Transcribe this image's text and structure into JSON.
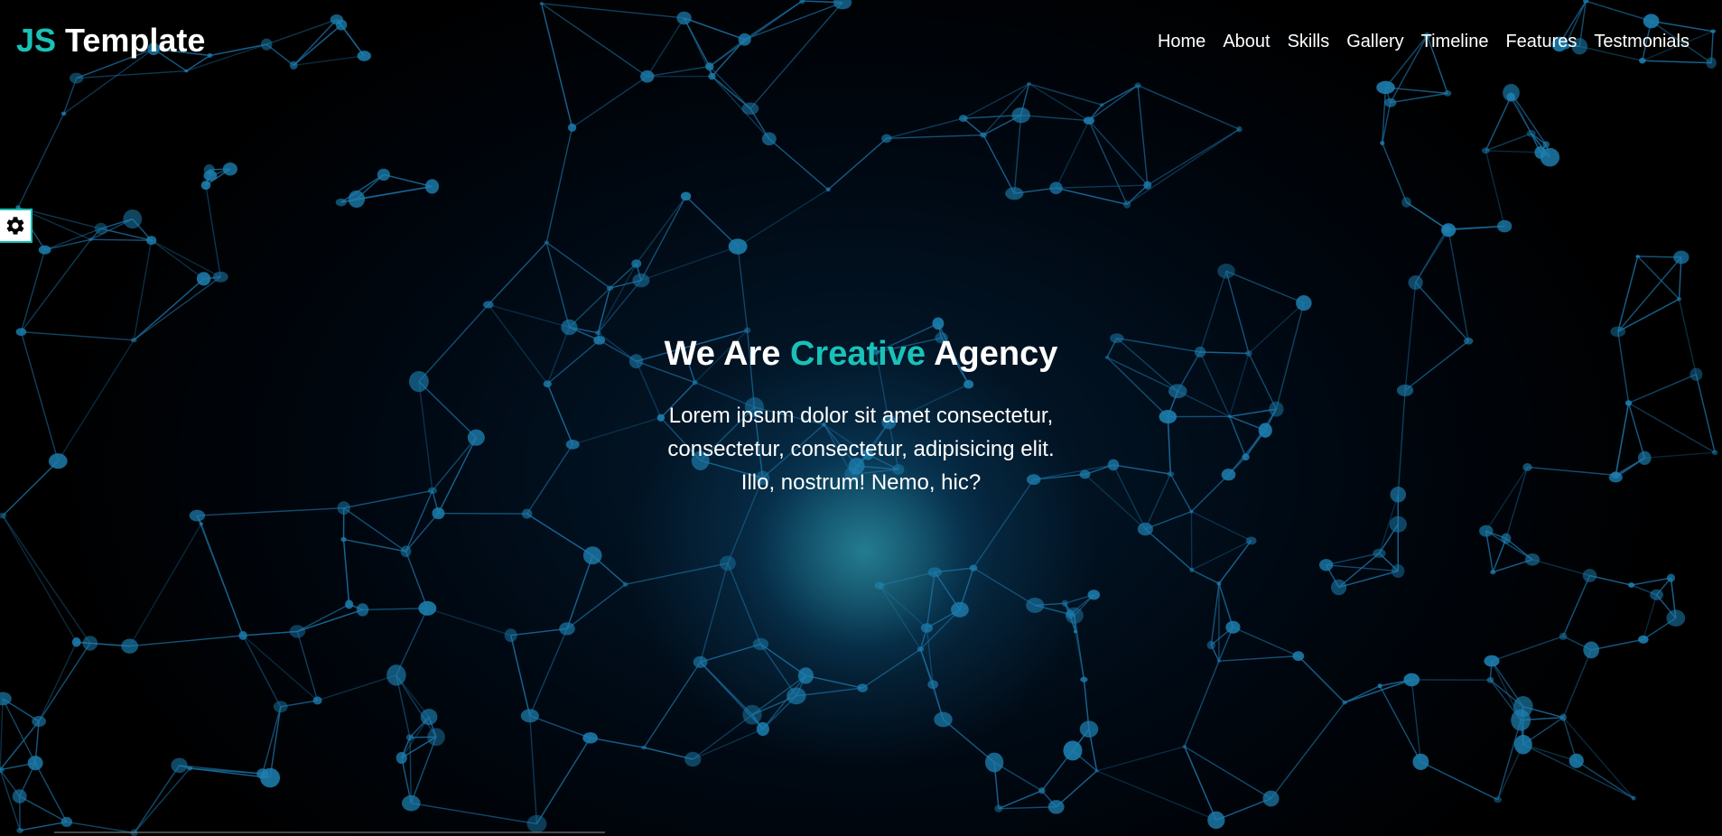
{
  "logo": {
    "accent": "JS",
    "rest": " Template"
  },
  "nav": {
    "items": [
      {
        "label": "Home"
      },
      {
        "label": "About"
      },
      {
        "label": "Skills"
      },
      {
        "label": "Gallery"
      },
      {
        "label": "Timeline"
      },
      {
        "label": "Features"
      },
      {
        "label": "Testmonials"
      }
    ]
  },
  "settings": {
    "icon": "gear-icon"
  },
  "hero": {
    "headline_before": "We Are ",
    "headline_accent": "Creative",
    "headline_after": " Agency",
    "lead": "Lorem ipsum dolor sit amet consectetur, consectetur, consectetur, adipisicing elit. Illo, nostrum! Nemo, hic?"
  },
  "colors": {
    "accent": "#19c2b8",
    "background": "#000000",
    "network_line": "#1a6a9a",
    "network_node": "#1d7fb0"
  }
}
